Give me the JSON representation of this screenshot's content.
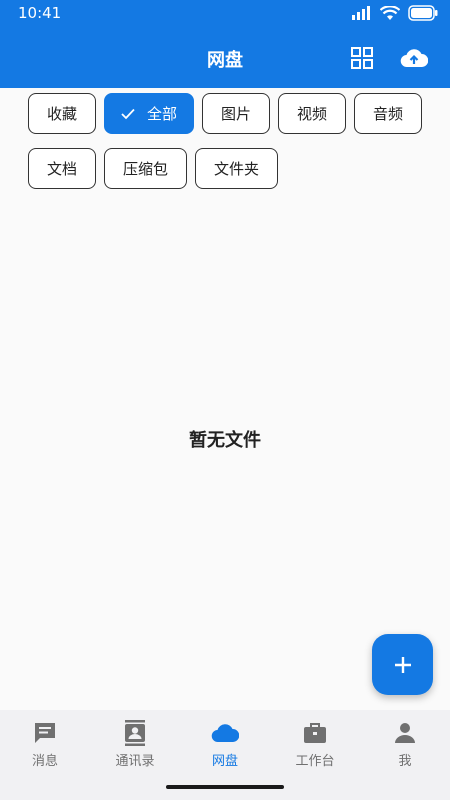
{
  "status_bar": {
    "time": "10:41"
  },
  "header": {
    "title": "网盘",
    "bg_color": "#1479e3"
  },
  "icons": {
    "grid": "grid-view-icon",
    "upload": "cloud-upload-icon",
    "check": "check-icon",
    "add": "plus-icon"
  },
  "filters": {
    "row1": [
      {
        "label": "收藏",
        "active": false
      },
      {
        "label": "全部",
        "active": true
      },
      {
        "label": "图片",
        "active": false
      },
      {
        "label": "视频",
        "active": false
      },
      {
        "label": "音频",
        "active": false
      }
    ],
    "row2": [
      {
        "label": "文档",
        "active": false
      },
      {
        "label": "压缩包",
        "active": false
      },
      {
        "label": "文件夹",
        "active": false
      }
    ]
  },
  "empty_state": {
    "text": "暂无文件"
  },
  "bottom_nav": {
    "items": [
      {
        "label": "消息",
        "icon": "message-icon",
        "active": false
      },
      {
        "label": "通讯录",
        "icon": "contacts-icon",
        "active": false
      },
      {
        "label": "网盘",
        "icon": "cloud-icon",
        "active": true
      },
      {
        "label": "工作台",
        "icon": "briefcase-icon",
        "active": false
      },
      {
        "label": "我",
        "icon": "person-icon",
        "active": false
      }
    ]
  },
  "colors": {
    "accent": "#1479e3",
    "nav_bg": "#f1f1f3",
    "nav_inactive": "#707070"
  }
}
